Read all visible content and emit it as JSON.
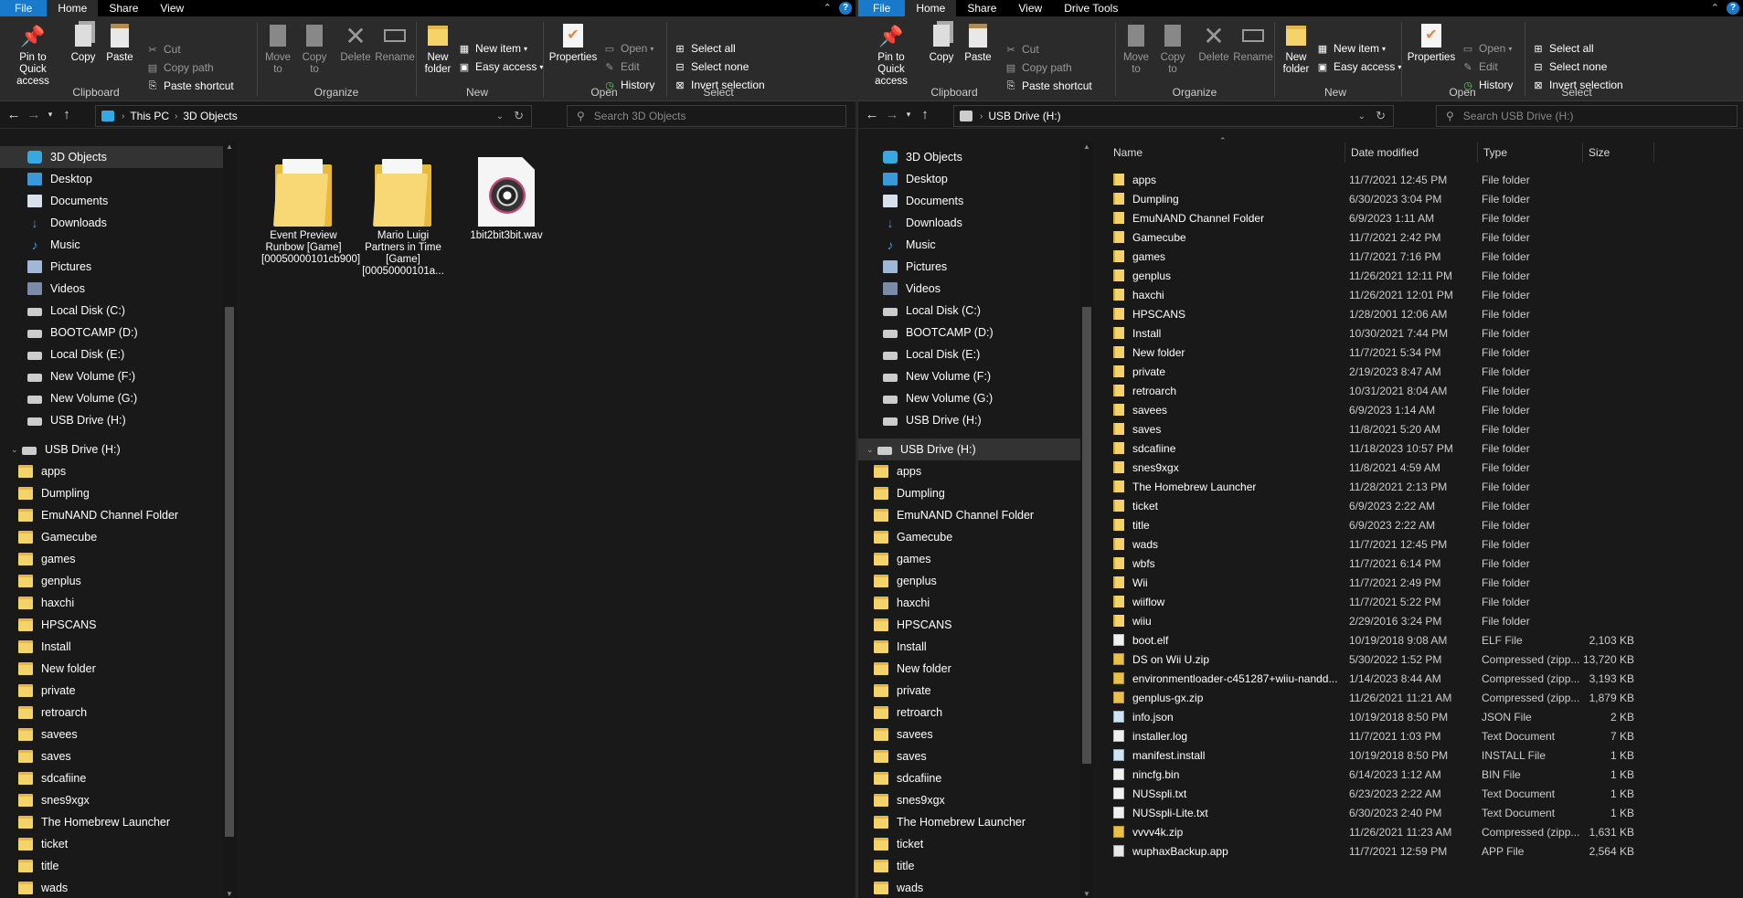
{
  "left": {
    "tabs": [
      "File",
      "Home",
      "Share",
      "View"
    ],
    "ribbon": {
      "clipboard": {
        "pin": "Pin to Quick access",
        "copy": "Copy",
        "paste": "Paste",
        "cut": "Cut",
        "copy_path": "Copy path",
        "paste_shortcut": "Paste shortcut",
        "label": "Clipboard"
      },
      "organize": {
        "move_to": "Move to",
        "copy_to": "Copy to",
        "delete": "Delete",
        "rename": "Rename",
        "label": "Organize"
      },
      "new": {
        "new_folder": "New folder",
        "new_item": "New item",
        "easy_access": "Easy access",
        "label": "New"
      },
      "open": {
        "properties": "Properties",
        "open": "Open",
        "edit": "Edit",
        "history": "History",
        "label": "Open"
      },
      "select": {
        "select_all": "Select all",
        "select_none": "Select none",
        "invert": "Invert selection",
        "label": "Select"
      }
    },
    "address": {
      "crumbs": [
        "This PC",
        "3D Objects"
      ],
      "search_placeholder": "Search 3D Objects"
    },
    "nav": [
      "3D Objects",
      "Desktop",
      "Documents",
      "Downloads",
      "Music",
      "Pictures",
      "Videos",
      "Local Disk (C:)",
      "BOOTCAMP (D:)",
      "Local Disk (E:)",
      "New Volume (F:)",
      "New Volume (G:)",
      "USB Drive (H:)"
    ],
    "nav_usb": "USB Drive (H:)",
    "nav_usb_children": [
      "apps",
      "Dumpling",
      "EmuNAND Channel Folder",
      "Gamecube",
      "games",
      "genplus",
      "haxchi",
      "HPSCANS",
      "Install",
      "New folder",
      "private",
      "retroarch",
      "savees",
      "saves",
      "sdcafiine",
      "snes9xgx",
      "The Homebrew Launcher",
      "ticket",
      "title",
      "wads"
    ],
    "files": [
      {
        "name": "Event Preview Runbow [Game] [00050000101cb900]",
        "type": "folder"
      },
      {
        "name": "Mario Luigi Partners in Time [Game] [00050000101a...",
        "type": "folder"
      },
      {
        "name": "1bit2bit3bit.wav",
        "type": "wav"
      }
    ]
  },
  "right": {
    "tabs": [
      "File",
      "Home",
      "Share",
      "View",
      "Drive Tools"
    ],
    "ribbon": {
      "clipboard": {
        "pin": "Pin to Quick access",
        "copy": "Copy",
        "paste": "Paste",
        "cut": "Cut",
        "copy_path": "Copy path",
        "paste_shortcut": "Paste shortcut",
        "label": "Clipboard"
      },
      "organize": {
        "move_to": "Move to",
        "copy_to": "Copy to",
        "delete": "Delete",
        "rename": "Rename",
        "label": "Organize"
      },
      "new": {
        "new_folder": "New folder",
        "new_item": "New item",
        "easy_access": "Easy access",
        "label": "New"
      },
      "open": {
        "properties": "Properties",
        "open": "Open",
        "edit": "Edit",
        "history": "History",
        "label": "Open"
      },
      "select": {
        "select_all": "Select all",
        "select_none": "Select none",
        "invert": "Invert selection",
        "label": "Select"
      }
    },
    "address": {
      "crumbs": [
        "USB Drive (H:)"
      ],
      "search_placeholder": "Search USB Drive (H:)"
    },
    "nav": [
      "3D Objects",
      "Desktop",
      "Documents",
      "Downloads",
      "Music",
      "Pictures",
      "Videos",
      "Local Disk (C:)",
      "BOOTCAMP (D:)",
      "Local Disk (E:)",
      "New Volume (F:)",
      "New Volume (G:)",
      "USB Drive (H:)"
    ],
    "nav_usb": "USB Drive (H:)",
    "nav_usb_children": [
      "apps",
      "Dumpling",
      "EmuNAND Channel Folder",
      "Gamecube",
      "games",
      "genplus",
      "haxchi",
      "HPSCANS",
      "Install",
      "New folder",
      "private",
      "retroarch",
      "savees",
      "saves",
      "sdcafiine",
      "snes9xgx",
      "The Homebrew Launcher",
      "ticket",
      "title",
      "wads"
    ],
    "columns": [
      "Name",
      "Date modified",
      "Type",
      "Size"
    ],
    "rows": [
      {
        "name": "apps",
        "date": "11/7/2021 12:45 PM",
        "type": "File folder",
        "size": "",
        "icon": "folder"
      },
      {
        "name": "Dumpling",
        "date": "6/30/2023 3:04 PM",
        "type": "File folder",
        "size": "",
        "icon": "folder"
      },
      {
        "name": "EmuNAND Channel Folder",
        "date": "6/9/2023 1:11 AM",
        "type": "File folder",
        "size": "",
        "icon": "folder"
      },
      {
        "name": "Gamecube",
        "date": "11/7/2021 2:42 PM",
        "type": "File folder",
        "size": "",
        "icon": "folder"
      },
      {
        "name": "games",
        "date": "11/7/2021 7:16 PM",
        "type": "File folder",
        "size": "",
        "icon": "folder"
      },
      {
        "name": "genplus",
        "date": "11/26/2021 12:11 PM",
        "type": "File folder",
        "size": "",
        "icon": "folder"
      },
      {
        "name": "haxchi",
        "date": "11/26/2021 12:01 PM",
        "type": "File folder",
        "size": "",
        "icon": "folder"
      },
      {
        "name": "HPSCANS",
        "date": "1/28/2001 12:06 AM",
        "type": "File folder",
        "size": "",
        "icon": "folder"
      },
      {
        "name": "Install",
        "date": "10/30/2021 7:44 PM",
        "type": "File folder",
        "size": "",
        "icon": "folder"
      },
      {
        "name": "New folder",
        "date": "11/7/2021 5:34 PM",
        "type": "File folder",
        "size": "",
        "icon": "folder"
      },
      {
        "name": "private",
        "date": "2/19/2023 8:47 AM",
        "type": "File folder",
        "size": "",
        "icon": "folder"
      },
      {
        "name": "retroarch",
        "date": "10/31/2021 8:04 AM",
        "type": "File folder",
        "size": "",
        "icon": "folder"
      },
      {
        "name": "savees",
        "date": "6/9/2023 1:14 AM",
        "type": "File folder",
        "size": "",
        "icon": "folder"
      },
      {
        "name": "saves",
        "date": "11/8/2021 5:20 AM",
        "type": "File folder",
        "size": "",
        "icon": "folder"
      },
      {
        "name": "sdcafiine",
        "date": "11/18/2023 10:57 PM",
        "type": "File folder",
        "size": "",
        "icon": "folder"
      },
      {
        "name": "snes9xgx",
        "date": "11/8/2021 4:59 AM",
        "type": "File folder",
        "size": "",
        "icon": "folder"
      },
      {
        "name": "The Homebrew Launcher",
        "date": "11/28/2021 2:13 PM",
        "type": "File folder",
        "size": "",
        "icon": "folder"
      },
      {
        "name": "ticket",
        "date": "6/9/2023 2:22 AM",
        "type": "File folder",
        "size": "",
        "icon": "folder"
      },
      {
        "name": "title",
        "date": "6/9/2023 2:22 AM",
        "type": "File folder",
        "size": "",
        "icon": "folder"
      },
      {
        "name": "wads",
        "date": "11/7/2021 12:45 PM",
        "type": "File folder",
        "size": "",
        "icon": "folder"
      },
      {
        "name": "wbfs",
        "date": "11/7/2021 6:14 PM",
        "type": "File folder",
        "size": "",
        "icon": "folder"
      },
      {
        "name": "Wii",
        "date": "11/7/2021 2:49 PM",
        "type": "File folder",
        "size": "",
        "icon": "folder"
      },
      {
        "name": "wiiflow",
        "date": "11/7/2021 5:22 PM",
        "type": "File folder",
        "size": "",
        "icon": "folder"
      },
      {
        "name": "wiiu",
        "date": "2/29/2016 3:24 PM",
        "type": "File folder",
        "size": "",
        "icon": "folder"
      },
      {
        "name": "boot.elf",
        "date": "10/19/2018 9:08 AM",
        "type": "ELF File",
        "size": "2,103 KB",
        "icon": "file"
      },
      {
        "name": "DS on Wii U.zip",
        "date": "5/30/2022 1:52 PM",
        "type": "Compressed (zipp...",
        "size": "13,720 KB",
        "icon": "zip"
      },
      {
        "name": "environmentloader-c451287+wiiu-nandd...",
        "date": "1/14/2023 8:44 AM",
        "type": "Compressed (zipp...",
        "size": "3,193 KB",
        "icon": "zip"
      },
      {
        "name": "genplus-gx.zip",
        "date": "11/26/2021 11:21 AM",
        "type": "Compressed (zipp...",
        "size": "1,879 KB",
        "icon": "zip"
      },
      {
        "name": "info.json",
        "date": "10/19/2018 8:50 PM",
        "type": "JSON File",
        "size": "2 KB",
        "icon": "json"
      },
      {
        "name": "installer.log",
        "date": "11/7/2021 1:03 PM",
        "type": "Text Document",
        "size": "7 KB",
        "icon": "file"
      },
      {
        "name": "manifest.install",
        "date": "10/19/2018 8:50 PM",
        "type": "INSTALL File",
        "size": "1 KB",
        "icon": "json"
      },
      {
        "name": "nincfg.bin",
        "date": "6/14/2023 1:12 AM",
        "type": "BIN File",
        "size": "1 KB",
        "icon": "file"
      },
      {
        "name": "NUSspli.txt",
        "date": "6/23/2023 2:22 AM",
        "type": "Text Document",
        "size": "1 KB",
        "icon": "file"
      },
      {
        "name": "NUSspli-Lite.txt",
        "date": "6/30/2023 2:40 PM",
        "type": "Text Document",
        "size": "1 KB",
        "icon": "file"
      },
      {
        "name": "vvvv4k.zip",
        "date": "11/26/2021 11:23 AM",
        "type": "Compressed (zipp...",
        "size": "1,631 KB",
        "icon": "zip"
      },
      {
        "name": "wuphaxBackup.app",
        "date": "11/7/2021 12:59 PM",
        "type": "APP File",
        "size": "2,564 KB",
        "icon": "app"
      }
    ]
  },
  "colors": {
    "accent": "#1979ca",
    "folder": "#f4d36b",
    "background": "#191919",
    "ribbon": "#2b2b2b"
  }
}
